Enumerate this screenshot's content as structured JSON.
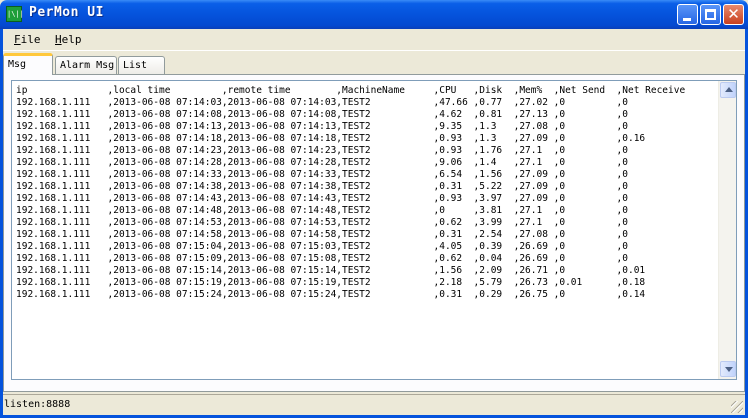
{
  "window": {
    "title": "PerMon UI",
    "icon_text": "|\\||"
  },
  "menu": {
    "file_accel": "F",
    "file_rest": "ile",
    "help_accel": "H",
    "help_rest": "elp"
  },
  "tabs": [
    {
      "label": "Msg"
    },
    {
      "label": "Alarm Msg"
    },
    {
      "label": "List"
    }
  ],
  "log": {
    "lines": [
      "ip              ,local time         ,remote time        ,MachineName     ,CPU   ,Disk  ,Mem%  ,Net Send  ,Net Receive",
      "192.168.1.111   ,2013-06-08 07:14:03,2013-06-08 07:14:03,TEST2           ,47.66 ,0.77  ,27.02 ,0         ,0",
      "192.168.1.111   ,2013-06-08 07:14:08,2013-06-08 07:14:08,TEST2           ,4.62  ,0.81  ,27.13 ,0         ,0",
      "192.168.1.111   ,2013-06-08 07:14:13,2013-06-08 07:14:13,TEST2           ,9.35  ,1.3   ,27.08 ,0         ,0",
      "192.168.1.111   ,2013-06-08 07:14:18,2013-06-08 07:14:18,TEST2           ,0.93  ,1.3   ,27.09 ,0         ,0.16",
      "192.168.1.111   ,2013-06-08 07:14:23,2013-06-08 07:14:23,TEST2           ,0.93  ,1.76  ,27.1  ,0         ,0",
      "192.168.1.111   ,2013-06-08 07:14:28,2013-06-08 07:14:28,TEST2           ,9.06  ,1.4   ,27.1  ,0         ,0",
      "192.168.1.111   ,2013-06-08 07:14:33,2013-06-08 07:14:33,TEST2           ,6.54  ,1.56  ,27.09 ,0         ,0",
      "192.168.1.111   ,2013-06-08 07:14:38,2013-06-08 07:14:38,TEST2           ,0.31  ,5.22  ,27.09 ,0         ,0",
      "192.168.1.111   ,2013-06-08 07:14:43,2013-06-08 07:14:43,TEST2           ,0.93  ,3.97  ,27.09 ,0         ,0",
      "192.168.1.111   ,2013-06-08 07:14:48,2013-06-08 07:14:48,TEST2           ,0     ,3.81  ,27.1  ,0         ,0",
      "192.168.1.111   ,2013-06-08 07:14:53,2013-06-08 07:14:53,TEST2           ,0.62  ,3.99  ,27.1  ,0         ,0",
      "192.168.1.111   ,2013-06-08 07:14:58,2013-06-08 07:14:58,TEST2           ,0.31  ,2.54  ,27.08 ,0         ,0",
      "192.168.1.111   ,2013-06-08 07:15:04,2013-06-08 07:15:03,TEST2           ,4.05  ,0.39  ,26.69 ,0         ,0",
      "192.168.1.111   ,2013-06-08 07:15:09,2013-06-08 07:15:08,TEST2           ,0.62  ,0.04  ,26.69 ,0         ,0",
      "192.168.1.111   ,2013-06-08 07:15:14,2013-06-08 07:15:14,TEST2           ,1.56  ,2.09  ,26.71 ,0         ,0.01",
      "192.168.1.111   ,2013-06-08 07:15:19,2013-06-08 07:15:19,TEST2           ,2.18  ,5.79  ,26.73 ,0.01      ,0.18",
      "192.168.1.111   ,2013-06-08 07:15:24,2013-06-08 07:15:24,TEST2           ,0.31  ,0.29  ,26.75 ,0         ,0.14"
    ]
  },
  "status": {
    "text": "listen:8888"
  },
  "colors": {
    "titlebar": "#0553DC",
    "active_tab_accent": "#FFC83C",
    "window_bg": "#ECE9D8"
  },
  "icons": {
    "app": "app-icon",
    "minimize": "minimize-icon",
    "maximize": "maximize-icon",
    "close": "close-icon",
    "scroll_up": "chevron-up-icon",
    "scroll_down": "chevron-down-icon"
  }
}
